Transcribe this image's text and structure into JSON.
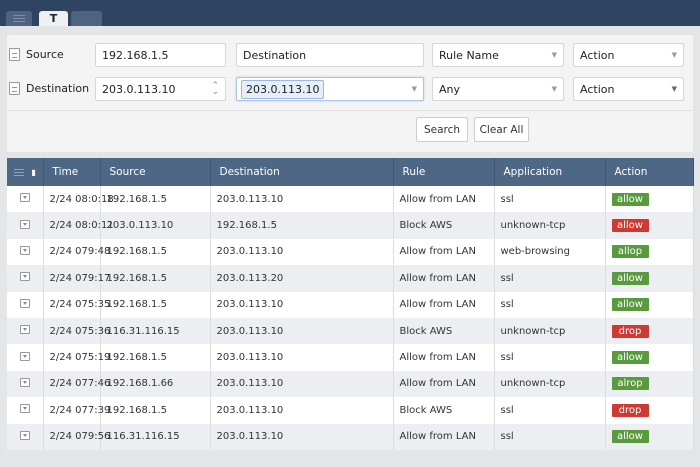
{
  "tabs": {
    "active_label": "T"
  },
  "filters": {
    "row1": {
      "label": "Source",
      "source_value": "192.168.1.5",
      "destination_placeholder": "Destination",
      "rule_placeholder": "Rule Name",
      "action_placeholder": "Action"
    },
    "row2": {
      "label": "Destination",
      "source_value": "203.0.113.10",
      "destination_value": "203.0.113.10",
      "rule_value": "Any",
      "action_placeholder": "Action"
    },
    "search_label": "Search",
    "clear_label": "Clear All"
  },
  "colors": {
    "header": "#4d6785",
    "allow": "#5a9a3f",
    "drop": "#cc3a33"
  },
  "table": {
    "headers": [
      "Time",
      "Source",
      "Destination",
      "Rule",
      "Application",
      "Action"
    ],
    "rows": [
      {
        "time": "2/24 08:0:18",
        "source": "192.168.1.5",
        "destination": "203.0.113.10",
        "rule": "Allow from LAN",
        "app": "ssl",
        "action": "allow",
        "color": "green"
      },
      {
        "time": "2/24 08:0:11",
        "source": "203.0.113.10",
        "destination": "192.168.1.5",
        "rule": "Block AWS",
        "app": "unknown-tcp",
        "action": "allow",
        "color": "red"
      },
      {
        "time": "2/24 079:48",
        "source": "192.168.1.5",
        "destination": "203.0.113.10",
        "rule": "Allow from LAN",
        "app": "web-browsing",
        "action": "allop",
        "color": "green"
      },
      {
        "time": "2/24 079:17",
        "source": "192.168.1.5",
        "destination": "203.0.113.20",
        "rule": "Allow from LAN",
        "app": "ssl",
        "action": "allow",
        "color": "green"
      },
      {
        "time": "2/24 075:35",
        "source": "192.168.1.5",
        "destination": "203.0.113.10",
        "rule": "Allow from LAN",
        "app": "ssl",
        "action": "allow",
        "color": "green"
      },
      {
        "time": "2/24 075:36",
        "source": "116.31.116.15",
        "destination": "203.0.113.10",
        "rule": "Block AWS",
        "app": "unknown-tcp",
        "action": "drop",
        "color": "red"
      },
      {
        "time": "2/24 075:19",
        "source": "192.168.1.5",
        "destination": "203.0.113.10",
        "rule": "Allow from LAN",
        "app": "ssl",
        "action": "allow",
        "color": "green"
      },
      {
        "time": "2/24 077:46",
        "source": "192.168.1.66",
        "destination": "203.0.113.10",
        "rule": "Allow from LAN",
        "app": "unknown-tcp",
        "action": "alrop",
        "color": "green"
      },
      {
        "time": "2/24 077:39",
        "source": "192.168.1.5",
        "destination": "203.0.113.10",
        "rule": "Block AWS",
        "app": "ssl",
        "action": "drop",
        "color": "red"
      },
      {
        "time": "2/24 079:56",
        "source": "116.31.116.15",
        "destination": "203.0.113.10",
        "rule": "Allow from LAN",
        "app": "ssl",
        "action": "allow",
        "color": "green"
      }
    ]
  }
}
